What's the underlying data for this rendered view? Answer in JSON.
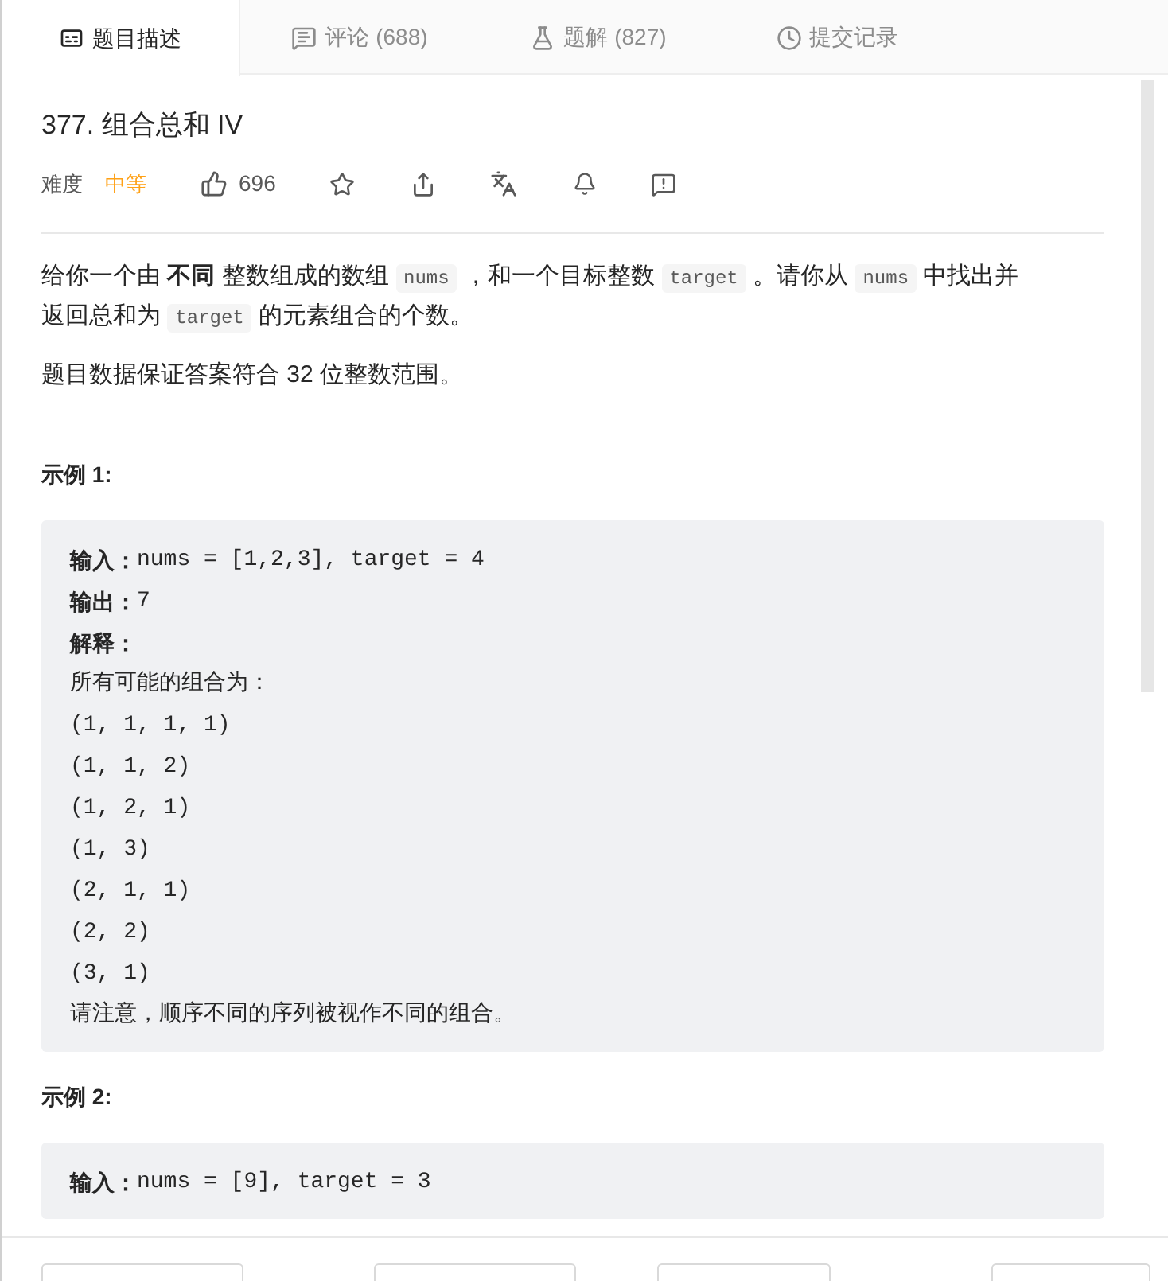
{
  "tabs": [
    {
      "label": "题目描述",
      "selected": true,
      "kind": "description"
    },
    {
      "label": "评论 (688)",
      "selected": false,
      "kind": "comment"
    },
    {
      "label": "题解 (827)",
      "selected": false,
      "kind": "flask"
    },
    {
      "label": "提交记录",
      "selected": false,
      "kind": "clock"
    }
  ],
  "problem": {
    "title": "377. 组合总和 IV",
    "difficulty_label": "难度",
    "difficulty": "中等",
    "likes": "696"
  },
  "description": [
    [
      {
        "kind": "text",
        "text": "给你一个由 "
      },
      {
        "kind": "bold",
        "text": "不同"
      },
      {
        "kind": "text",
        "text": " 整数组成的数组 "
      },
      {
        "kind": "code",
        "text": "nums"
      },
      {
        "kind": "text",
        "text": " ，和一个目标整数 "
      },
      {
        "kind": "code",
        "text": "target"
      },
      {
        "kind": "text",
        "text": " 。请你从 "
      },
      {
        "kind": "code",
        "text": "nums"
      },
      {
        "kind": "text",
        "text": " 中找出并"
      },
      {
        "kind": "text",
        "text": "返回总和为 "
      },
      {
        "kind": "code",
        "text": "target"
      },
      {
        "kind": "text",
        "text": " 的元素组合的个数。"
      }
    ],
    [
      {
        "kind": "text",
        "text": "题目数据保证答案符合 32 位整数范围。"
      }
    ]
  ],
  "examples": [
    {
      "title": "示例 1:",
      "lines": [
        {
          "kind": "labeled",
          "label": "输入：",
          "text": "nums = [1,2,3], target = 4"
        },
        {
          "kind": "labeled",
          "label": "输出：",
          "text": "7"
        },
        {
          "kind": "labeled",
          "label": "解释："
        },
        {
          "kind": "plain",
          "text": "所有可能的组合为："
        },
        {
          "kind": "plain",
          "text": "(1, 1, 1, 1)"
        },
        {
          "kind": "plain",
          "text": "(1, 1, 2)"
        },
        {
          "kind": "plain",
          "text": "(1, 2, 1)"
        },
        {
          "kind": "plain",
          "text": "(1, 3)"
        },
        {
          "kind": "plain",
          "text": "(2, 1, 1)"
        },
        {
          "kind": "plain",
          "text": "(2, 2)"
        },
        {
          "kind": "plain",
          "text": "(3, 1)"
        },
        {
          "kind": "plain",
          "text": "请注意，顺序不同的序列被视作不同的组合。"
        }
      ]
    },
    {
      "title": "示例 2:",
      "lines": [
        {
          "kind": "labeled",
          "label": "输入：",
          "text": "nums = [9], target = 3"
        }
      ]
    }
  ]
}
